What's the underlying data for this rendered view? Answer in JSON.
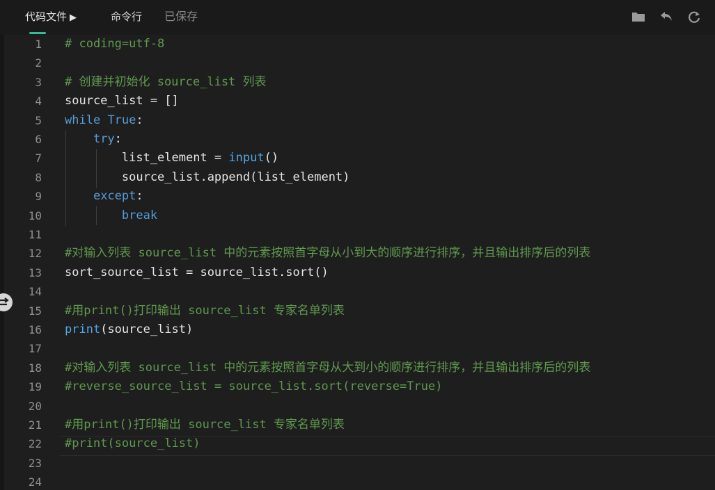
{
  "topbar": {
    "tab_file": "代码文件",
    "tab_file_play": "▶",
    "tab_terminal": "命令行",
    "status": "已保存",
    "icons": [
      "folder-icon",
      "undo-icon",
      "refresh-icon"
    ]
  },
  "editor": {
    "current_line": 22,
    "lines": [
      {
        "n": "1",
        "tokens": [
          {
            "t": "# coding=utf-8",
            "c": "c"
          }
        ]
      },
      {
        "n": "2",
        "tokens": []
      },
      {
        "n": "3",
        "tokens": [
          {
            "t": "# 创建并初始化 source_list 列表",
            "c": "c"
          }
        ]
      },
      {
        "n": "4",
        "tokens": [
          {
            "t": "source_list = []",
            "c": "p"
          }
        ]
      },
      {
        "n": "5",
        "tokens": [
          {
            "t": "while",
            "c": "k"
          },
          {
            "t": " ",
            "c": "p"
          },
          {
            "t": "True",
            "c": "k"
          },
          {
            "t": ":",
            "c": "p"
          }
        ]
      },
      {
        "n": "6",
        "tokens": [
          {
            "t": "    ",
            "c": "p"
          },
          {
            "t": "try",
            "c": "k"
          },
          {
            "t": ":",
            "c": "p"
          }
        ]
      },
      {
        "n": "7",
        "tokens": [
          {
            "t": "        list_element = ",
            "c": "p"
          },
          {
            "t": "input",
            "c": "f"
          },
          {
            "t": "()",
            "c": "p"
          }
        ]
      },
      {
        "n": "8",
        "tokens": [
          {
            "t": "        source_list.append(list_element)",
            "c": "p"
          }
        ]
      },
      {
        "n": "9",
        "tokens": [
          {
            "t": "    ",
            "c": "p"
          },
          {
            "t": "except",
            "c": "k"
          },
          {
            "t": ":",
            "c": "p"
          }
        ]
      },
      {
        "n": "10",
        "tokens": [
          {
            "t": "        ",
            "c": "p"
          },
          {
            "t": "break",
            "c": "k"
          }
        ]
      },
      {
        "n": "11",
        "tokens": []
      },
      {
        "n": "12",
        "tokens": [
          {
            "t": "#对输入列表 source_list 中的元素按照首字母从小到大的顺序进行排序，并且输出排序后的列表",
            "c": "c"
          }
        ]
      },
      {
        "n": "13",
        "tokens": [
          {
            "t": "sort_source_list = source_list.sort()",
            "c": "p"
          }
        ]
      },
      {
        "n": "14",
        "tokens": []
      },
      {
        "n": "15",
        "tokens": [
          {
            "t": "#用print()打印输出 source_list 专家名单列表",
            "c": "c"
          }
        ]
      },
      {
        "n": "16",
        "tokens": [
          {
            "t": "print",
            "c": "f"
          },
          {
            "t": "(source_list)",
            "c": "p"
          }
        ]
      },
      {
        "n": "17",
        "tokens": []
      },
      {
        "n": "18",
        "tokens": [
          {
            "t": "#对输入列表 source_list 中的元素按照首字母从大到小的顺序进行排序，并且输出排序后的列表",
            "c": "c"
          }
        ]
      },
      {
        "n": "19",
        "tokens": [
          {
            "t": "#reverse_source_list = source_list.sort(reverse=True)",
            "c": "c"
          }
        ]
      },
      {
        "n": "20",
        "tokens": []
      },
      {
        "n": "21",
        "tokens": [
          {
            "t": "#用print()打印输出 source_list 专家名单列表",
            "c": "c"
          }
        ]
      },
      {
        "n": "22",
        "tokens": [
          {
            "t": "#print(source_list)",
            "c": "c"
          }
        ]
      },
      {
        "n": "23",
        "tokens": []
      },
      {
        "n": "24",
        "tokens": []
      }
    ]
  }
}
